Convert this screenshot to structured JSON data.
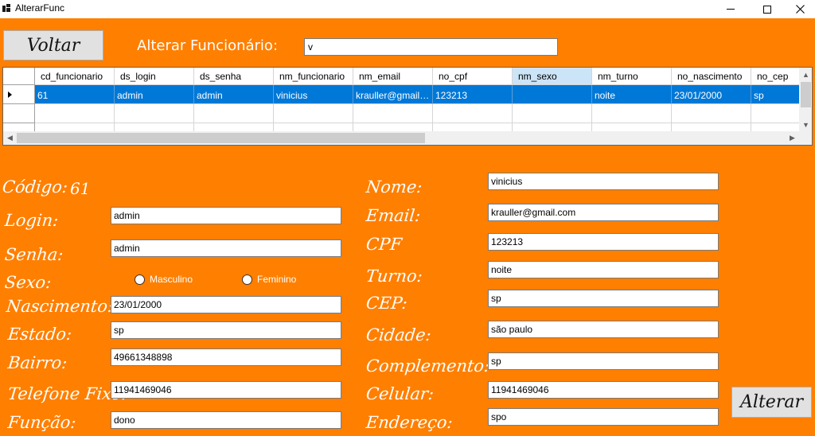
{
  "window": {
    "title": "AlterarFunc"
  },
  "header": {
    "voltar_label": "Voltar",
    "title": "Alterar Funcionário:",
    "search_value": "v"
  },
  "grid": {
    "columns": [
      "cd_funcionario",
      "ds_login",
      "ds_senha",
      "nm_funcionario",
      "nm_email",
      "no_cpf",
      "nm_sexo",
      "nm_turno",
      "no_nascimento",
      "no_cep"
    ],
    "selected_column": "nm_sexo",
    "rows": [
      [
        "61",
        "admin",
        "admin",
        "vinicius",
        "krauller@gmail....",
        "123213",
        "",
        "noite",
        "23/01/2000",
        "sp"
      ]
    ]
  },
  "form": {
    "codigo_label": "Código:",
    "codigo_value": "61",
    "login_label": "Login:",
    "login_value": "admin",
    "senha_label": "Senha:",
    "senha_value": "admin",
    "sexo_label": "Sexo:",
    "sexo_options": [
      "Masculino",
      "Feminino"
    ],
    "nascimento_label": "Nascimento:",
    "nascimento_value": "23/01/2000",
    "estado_label": "Estado:",
    "estado_value": "sp",
    "bairro_label": "Bairro:",
    "bairro_value": "49661348898",
    "telefone_label": "Telefone Fixo:",
    "telefone_value": "11941469046",
    "funcao_label": "Função:",
    "funcao_value": "dono",
    "nome_label": "Nome:",
    "nome_value": "vinicius",
    "email_label": "Email:",
    "email_value": "krauller@gmail.com",
    "cpf_label": "CPF",
    "cpf_value": "123213",
    "turno_label": "Turno:",
    "turno_value": "noite",
    "cep_label": "CEP:",
    "cep_value": "sp",
    "cidade_label": "Cidade:",
    "cidade_value": "são paulo",
    "complemento_label": "Complemento:",
    "complemento_value": "sp",
    "celular_label": "Celular:",
    "celular_value": "11941469046",
    "endereco_label": "Endereço:",
    "endereco_value": "spo",
    "alterar_label": "Alterar"
  },
  "colors": {
    "form_background": "#ff7f00",
    "selection": "#0078d7",
    "selected_header": "#cce4f7"
  }
}
